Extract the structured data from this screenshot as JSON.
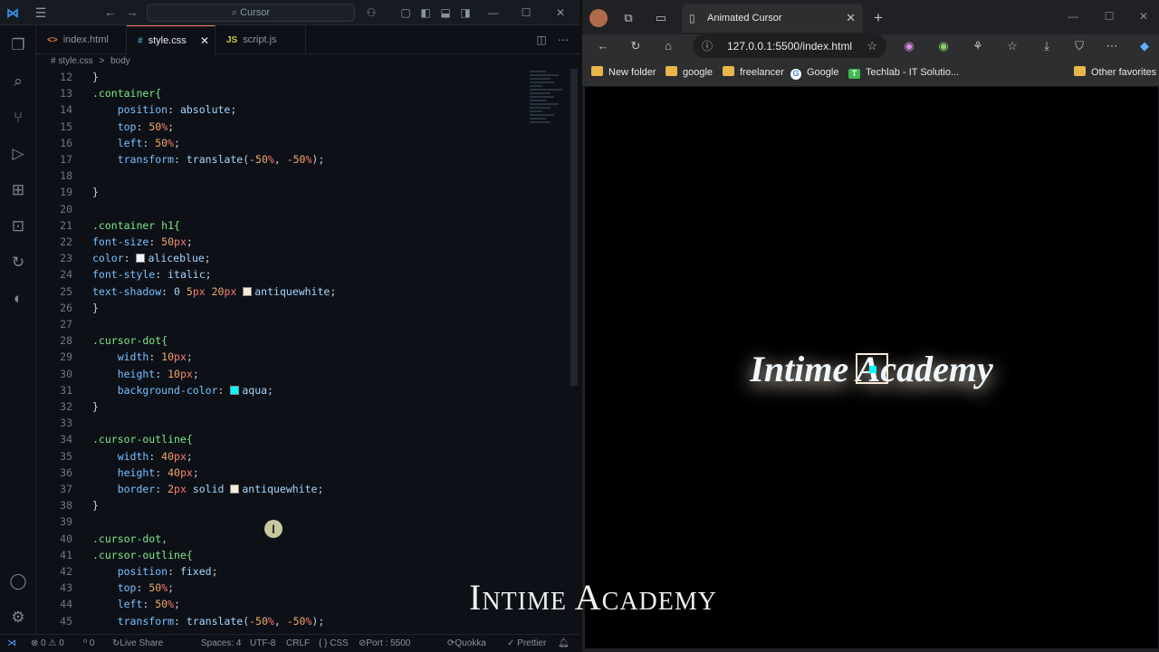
{
  "vscode": {
    "search": "Cursor",
    "tabs": [
      {
        "icon": "<>",
        "label": "index.html"
      },
      {
        "icon": "#",
        "label": "style.css"
      },
      {
        "icon": "JS",
        "label": "script.js"
      }
    ],
    "breadcrumb": {
      "file": "# style.css",
      "sep": ">",
      "node": "body"
    },
    "lines": [
      {
        "n": "12",
        "t": [
          [
            "}",
            "pun"
          ]
        ]
      },
      {
        "n": "13",
        "t": [
          [
            ".container{",
            "sel"
          ]
        ]
      },
      {
        "n": "14",
        "t": [
          [
            "    position",
            "prop"
          ],
          [
            ": ",
            "pun"
          ],
          [
            "absolute",
            "val"
          ],
          [
            ";",
            "pun"
          ]
        ]
      },
      {
        "n": "15",
        "t": [
          [
            "    top",
            "prop"
          ],
          [
            ": ",
            "pun"
          ],
          [
            "50",
            "num"
          ],
          [
            "%",
            "unit"
          ],
          [
            ";",
            "pun"
          ]
        ]
      },
      {
        "n": "16",
        "t": [
          [
            "    left",
            "prop"
          ],
          [
            ": ",
            "pun"
          ],
          [
            "50",
            "num"
          ],
          [
            "%",
            "unit"
          ],
          [
            ";",
            "pun"
          ]
        ]
      },
      {
        "n": "17",
        "t": [
          [
            "    transform",
            "prop"
          ],
          [
            ": ",
            "pun"
          ],
          [
            "translate",
            "val"
          ],
          [
            "(",
            "pun"
          ],
          [
            "-50",
            "num"
          ],
          [
            "%",
            "unit"
          ],
          [
            ", ",
            "pun"
          ],
          [
            "-50",
            "num"
          ],
          [
            "%",
            "unit"
          ],
          [
            ");",
            "pun"
          ]
        ]
      },
      {
        "n": "18",
        "t": []
      },
      {
        "n": "19",
        "t": [
          [
            "}",
            "pun"
          ]
        ]
      },
      {
        "n": "20",
        "t": []
      },
      {
        "n": "21",
        "t": [
          [
            ".container h1{",
            "sel"
          ]
        ]
      },
      {
        "n": "22",
        "t": [
          [
            "font-size",
            "prop"
          ],
          [
            ": ",
            "pun"
          ],
          [
            "50",
            "num"
          ],
          [
            "px",
            "unit"
          ],
          [
            ";",
            "pun"
          ]
        ]
      },
      {
        "n": "23",
        "t": [
          [
            "color",
            "prop"
          ],
          [
            ": ",
            "pun"
          ],
          [
            "#f0f8ff",
            "swatch"
          ],
          [
            "aliceblue",
            "val"
          ],
          [
            ";",
            "pun"
          ]
        ]
      },
      {
        "n": "24",
        "t": [
          [
            "font-style",
            "prop"
          ],
          [
            ": ",
            "pun"
          ],
          [
            "italic",
            "val"
          ],
          [
            ";",
            "pun"
          ]
        ]
      },
      {
        "n": "25",
        "t": [
          [
            "text-shadow",
            "prop"
          ],
          [
            ": ",
            "pun"
          ],
          [
            "0 ",
            "val"
          ],
          [
            "5",
            "num"
          ],
          [
            "px ",
            "unit"
          ],
          [
            "20",
            "num"
          ],
          [
            "px ",
            "unit"
          ],
          [
            "#faebd7",
            "swatch"
          ],
          [
            "antiquewhite",
            "val"
          ],
          [
            ";",
            "pun"
          ]
        ]
      },
      {
        "n": "26",
        "t": [
          [
            "}",
            "pun"
          ]
        ]
      },
      {
        "n": "27",
        "t": []
      },
      {
        "n": "28",
        "t": [
          [
            ".cursor-dot{",
            "sel"
          ]
        ]
      },
      {
        "n": "29",
        "t": [
          [
            "    width",
            "prop"
          ],
          [
            ": ",
            "pun"
          ],
          [
            "10",
            "num"
          ],
          [
            "px",
            "unit"
          ],
          [
            ";",
            "pun"
          ]
        ]
      },
      {
        "n": "30",
        "t": [
          [
            "    height",
            "prop"
          ],
          [
            ": ",
            "pun"
          ],
          [
            "10",
            "num"
          ],
          [
            "px",
            "unit"
          ],
          [
            ";",
            "pun"
          ]
        ]
      },
      {
        "n": "31",
        "t": [
          [
            "    background-color",
            "prop"
          ],
          [
            ": ",
            "pun"
          ],
          [
            "#00ffff",
            "swatch"
          ],
          [
            "aqua",
            "val"
          ],
          [
            ";",
            "pun"
          ]
        ]
      },
      {
        "n": "32",
        "t": [
          [
            "}",
            "pun"
          ]
        ]
      },
      {
        "n": "33",
        "t": []
      },
      {
        "n": "34",
        "t": [
          [
            ".cursor-outline{",
            "sel"
          ]
        ]
      },
      {
        "n": "35",
        "t": [
          [
            "    width",
            "prop"
          ],
          [
            ": ",
            "pun"
          ],
          [
            "40",
            "num"
          ],
          [
            "px",
            "unit"
          ],
          [
            ";",
            "pun"
          ]
        ]
      },
      {
        "n": "36",
        "t": [
          [
            "    height",
            "prop"
          ],
          [
            ": ",
            "pun"
          ],
          [
            "40",
            "num"
          ],
          [
            "px",
            "unit"
          ],
          [
            ";",
            "pun"
          ]
        ]
      },
      {
        "n": "37",
        "t": [
          [
            "    border",
            "prop"
          ],
          [
            ": ",
            "pun"
          ],
          [
            "2",
            "num"
          ],
          [
            "px ",
            "unit"
          ],
          [
            "solid ",
            "val"
          ],
          [
            "#faebd7",
            "swatch"
          ],
          [
            "antiquewhite",
            "val"
          ],
          [
            ";",
            "pun"
          ]
        ]
      },
      {
        "n": "38",
        "t": [
          [
            "}",
            "pun"
          ]
        ]
      },
      {
        "n": "39",
        "t": []
      },
      {
        "n": "40",
        "t": [
          [
            ".cursor-dot,",
            "sel"
          ]
        ]
      },
      {
        "n": "41",
        "t": [
          [
            ".cursor-outline{",
            "sel"
          ]
        ]
      },
      {
        "n": "42",
        "t": [
          [
            "    position",
            "prop"
          ],
          [
            ": ",
            "pun"
          ],
          [
            "fixed",
            "val"
          ],
          [
            ";",
            "pun"
          ]
        ]
      },
      {
        "n": "43",
        "t": [
          [
            "    top",
            "prop"
          ],
          [
            ": ",
            "pun"
          ],
          [
            "50",
            "num"
          ],
          [
            "%",
            "unit"
          ],
          [
            ";",
            "pun"
          ]
        ]
      },
      {
        "n": "44",
        "t": [
          [
            "    left",
            "prop"
          ],
          [
            ": ",
            "pun"
          ],
          [
            "50",
            "num"
          ],
          [
            "%",
            "unit"
          ],
          [
            ";",
            "pun"
          ]
        ]
      },
      {
        "n": "45",
        "t": [
          [
            "    transform",
            "prop"
          ],
          [
            ": ",
            "pun"
          ],
          [
            "translate",
            "val"
          ],
          [
            "(",
            "pun"
          ],
          [
            "-50",
            "num"
          ],
          [
            "%",
            "unit"
          ],
          [
            ", ",
            "pun"
          ],
          [
            "-50",
            "num"
          ],
          [
            "%",
            "unit"
          ],
          [
            ");",
            "pun"
          ]
        ]
      }
    ],
    "status": {
      "errors": "⊗ 0 ⚠ 0",
      "ports": "⁰ 0",
      "live_share": "Live Share",
      "spaces": "Spaces: 4",
      "encoding": "UTF-8",
      "eol": "CRLF",
      "language": "{ } CSS",
      "port": "Port : 5500",
      "quokka": "Quokka",
      "prettier": "✓ Prettier"
    }
  },
  "edge": {
    "tab_title": "Animated Cursor",
    "address": "127.0.0.1:5500/index.html",
    "bookmarks": [
      {
        "label": "New folder",
        "icon": "folder"
      },
      {
        "label": "google",
        "icon": "folder"
      },
      {
        "label": "freelancer",
        "icon": "folder"
      },
      {
        "label": "Google",
        "icon": "google"
      },
      {
        "label": "Techlab - IT Solutio...",
        "icon": "techlab"
      }
    ],
    "other_favorites": "Other favorites",
    "page_heading": "Intime Academy"
  },
  "watermark": "Intime Academy"
}
